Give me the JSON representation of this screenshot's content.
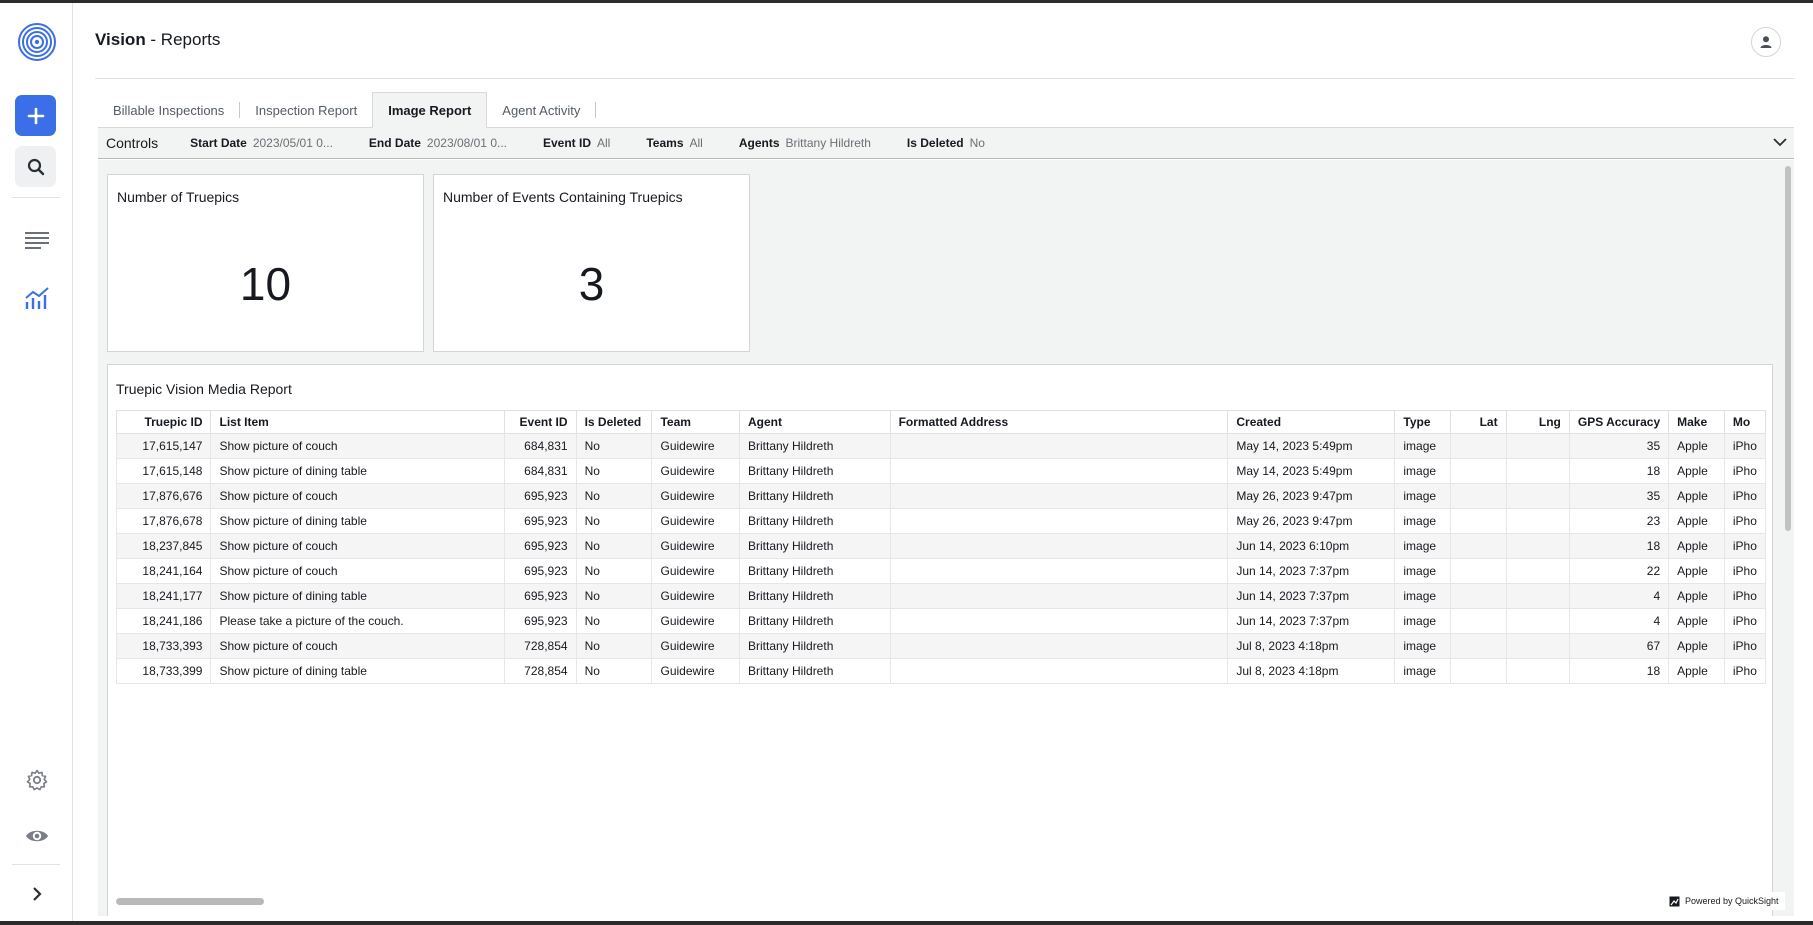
{
  "app": {
    "title_bold": "Vision",
    "title_rest": " - Reports"
  },
  "tabs": [
    {
      "label": "Billable Inspections"
    },
    {
      "label": "Inspection Report"
    },
    {
      "label": "Image Report"
    },
    {
      "label": "Agent Activity"
    }
  ],
  "controls": {
    "title": "Controls",
    "items": [
      {
        "label": "Start Date",
        "value": "2023/05/01 0..."
      },
      {
        "label": "End Date",
        "value": "2023/08/01 0..."
      },
      {
        "label": "Event ID",
        "value": "All"
      },
      {
        "label": "Teams",
        "value": "All"
      },
      {
        "label": "Agents",
        "value": "Brittany Hildreth"
      },
      {
        "label": "Is Deleted",
        "value": "No"
      }
    ]
  },
  "kpis": [
    {
      "title": "Number of Truepics",
      "value": "10"
    },
    {
      "title": "Number of Events Containing Truepics",
      "value": "3"
    }
  ],
  "report": {
    "title": "Truepic Vision Media Report",
    "columns": [
      "Truepic ID",
      "List Item",
      "Event ID",
      "Is Deleted",
      "Team",
      "Agent",
      "Formatted Address",
      "Created",
      "Type",
      "Lat",
      "Lng",
      "GPS Accuracy",
      "Make",
      "Mo"
    ],
    "rows": [
      [
        "17,615,147",
        "Show picture of couch",
        "684,831",
        "No",
        "Guidewire",
        "Brittany Hildreth",
        "",
        "May 14, 2023 5:49pm",
        "image",
        "",
        "",
        "35",
        "Apple",
        "iPho"
      ],
      [
        "17,615,148",
        "Show picture of dining table",
        "684,831",
        "No",
        "Guidewire",
        "Brittany Hildreth",
        "",
        "May 14, 2023 5:49pm",
        "image",
        "",
        "",
        "18",
        "Apple",
        "iPho"
      ],
      [
        "17,876,676",
        "Show picture of couch",
        "695,923",
        "No",
        "Guidewire",
        "Brittany Hildreth",
        "",
        "May 26, 2023 9:47pm",
        "image",
        "",
        "",
        "35",
        "Apple",
        "iPho"
      ],
      [
        "17,876,678",
        "Show picture of dining table",
        "695,923",
        "No",
        "Guidewire",
        "Brittany Hildreth",
        "",
        "May 26, 2023 9:47pm",
        "image",
        "",
        "",
        "23",
        "Apple",
        "iPho"
      ],
      [
        "18,237,845",
        "Show picture of couch",
        "695,923",
        "No",
        "Guidewire",
        "Brittany Hildreth",
        "",
        "Jun 14, 2023 6:10pm",
        "image",
        "",
        "",
        "18",
        "Apple",
        "iPho"
      ],
      [
        "18,241,164",
        "Show picture of couch",
        "695,923",
        "No",
        "Guidewire",
        "Brittany Hildreth",
        "",
        "Jun 14, 2023 7:37pm",
        "image",
        "",
        "",
        "22",
        "Apple",
        "iPho"
      ],
      [
        "18,241,177",
        "Show picture of dining table",
        "695,923",
        "No",
        "Guidewire",
        "Brittany Hildreth",
        "",
        "Jun 14, 2023 7:37pm",
        "image",
        "",
        "",
        "4",
        "Apple",
        "iPho"
      ],
      [
        "18,241,186",
        "Please take a picture of the couch.",
        "695,923",
        "No",
        "Guidewire",
        "Brittany Hildreth",
        "",
        "Jun 14, 2023 7:37pm",
        "image",
        "",
        "",
        "4",
        "Apple",
        "iPho"
      ],
      [
        "18,733,393",
        "Show picture of couch",
        "728,854",
        "No",
        "Guidewire",
        "Brittany Hildreth",
        "",
        "Jul 8, 2023 4:18pm",
        "image",
        "",
        "",
        "67",
        "Apple",
        "iPho"
      ],
      [
        "18,733,399",
        "Show picture of dining table",
        "728,854",
        "No",
        "Guidewire",
        "Brittany Hildreth",
        "",
        "Jul 8, 2023 4:18pm",
        "image",
        "",
        "",
        "18",
        "Apple",
        "iPho"
      ]
    ]
  },
  "footer": {
    "powered_by": "Powered by QuickSight"
  },
  "colors": {
    "accent": "#3b6fe8",
    "canvas": "#f2f3f3",
    "text": "#16191f"
  },
  "icons": [
    "app-logo-icon",
    "plus-icon",
    "search-icon",
    "list-icon",
    "chart-icon",
    "gear-icon",
    "eye-icon",
    "chevron-right-icon",
    "user-icon",
    "chevron-down-icon",
    "quicksight-icon"
  ]
}
